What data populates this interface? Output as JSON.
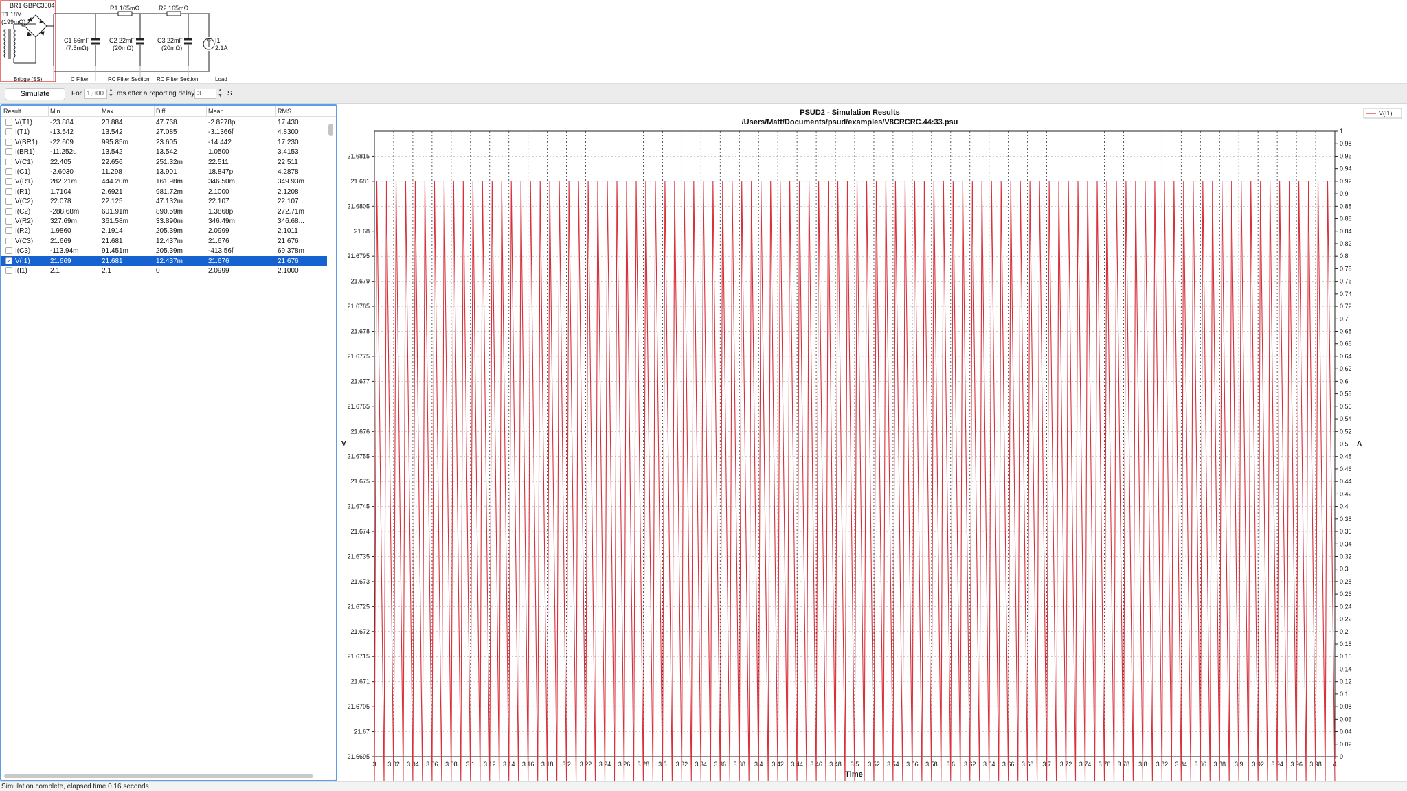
{
  "schematic": {
    "bridge_label": "BR1 GBPC3504",
    "transformer_label": "T1 18V",
    "transformer_res": "(199mΩ)",
    "r1": "R1 165mΩ",
    "r2": "R2 165mΩ",
    "c1": "C1 66mF",
    "c1_esr": "(7.5mΩ)",
    "c2": "C2 22mF",
    "c2_esr": "(20mΩ)",
    "c3": "C3 22mF",
    "c3_esr": "(20mΩ)",
    "i1": "I1",
    "i1_value": "2.1A",
    "sections": [
      "Bridge (SS)",
      "C Filter",
      "RC Filter Section",
      "RC Filter Section",
      "Load"
    ]
  },
  "controls": {
    "simulate_label": "Simulate",
    "for_label": "For",
    "duration_value": "1,000",
    "after_label": "ms after a reporting delay",
    "delay_value": "3",
    "unit_label": "S"
  },
  "table": {
    "headers": [
      "Result",
      "Min",
      "Max",
      "Diff",
      "Mean",
      "RMS"
    ],
    "rows": [
      {
        "name": "V(T1)",
        "min": "-23.884",
        "max": "23.884",
        "diff": "47.768",
        "mean": "-2.8278p",
        "rms": "17.430",
        "checked": false
      },
      {
        "name": "I(T1)",
        "min": "-13.542",
        "max": "13.542",
        "diff": "27.085",
        "mean": "-3.1366f",
        "rms": "4.8300",
        "checked": false
      },
      {
        "name": "V(BR1)",
        "min": "-22.609",
        "max": "995.85m",
        "diff": "23.605",
        "mean": "-14.442",
        "rms": "17.230",
        "checked": false
      },
      {
        "name": "I(BR1)",
        "min": "-11.252u",
        "max": "13.542",
        "diff": "13.542",
        "mean": "1.0500",
        "rms": "3.4153",
        "checked": false
      },
      {
        "name": "V(C1)",
        "min": "22.405",
        "max": "22.656",
        "diff": "251.32m",
        "mean": "22.511",
        "rms": "22.511",
        "checked": false
      },
      {
        "name": "I(C1)",
        "min": "-2.6030",
        "max": "11.298",
        "diff": "13.901",
        "mean": "18.847p",
        "rms": "4.2878",
        "checked": false
      },
      {
        "name": "V(R1)",
        "min": "282.21m",
        "max": "444.20m",
        "diff": "161.98m",
        "mean": "346.50m",
        "rms": "349.93m",
        "checked": false
      },
      {
        "name": "I(R1)",
        "min": "1.7104",
        "max": "2.6921",
        "diff": "981.72m",
        "mean": "2.1000",
        "rms": "2.1208",
        "checked": false
      },
      {
        "name": "V(C2)",
        "min": "22.078",
        "max": "22.125",
        "diff": "47.132m",
        "mean": "22.107",
        "rms": "22.107",
        "checked": false
      },
      {
        "name": "I(C2)",
        "min": "-288.68m",
        "max": "601.91m",
        "diff": "890.59m",
        "mean": "1.3868p",
        "rms": "272.71m",
        "checked": false
      },
      {
        "name": "V(R2)",
        "min": "327.69m",
        "max": "361.58m",
        "diff": "33.890m",
        "mean": "346.49m",
        "rms": "346.68...",
        "checked": false
      },
      {
        "name": "I(R2)",
        "min": "1.9860",
        "max": "2.1914",
        "diff": "205.39m",
        "mean": "2.0999",
        "rms": "2.1011",
        "checked": false
      },
      {
        "name": "V(C3)",
        "min": "21.669",
        "max": "21.681",
        "diff": "12.437m",
        "mean": "21.676",
        "rms": "21.676",
        "checked": false
      },
      {
        "name": "I(C3)",
        "min": "-113.94m",
        "max": "91.451m",
        "diff": "205.39m",
        "mean": "-413.56f",
        "rms": "69.378m",
        "checked": false
      },
      {
        "name": "V(I1)",
        "min": "21.669",
        "max": "21.681",
        "diff": "12.437m",
        "mean": "21.676",
        "rms": "21.676",
        "checked": true
      },
      {
        "name": "I(I1)",
        "min": "2.1",
        "max": "2.1",
        "diff": "0",
        "mean": "2.0999",
        "rms": "2.1000",
        "checked": false
      }
    ]
  },
  "chart_data": {
    "type": "line",
    "title": "PSUD2 - Simulation Results",
    "subtitle": "/Users/Matt/Documents/psud/examples/V8CRCRC.44:33.psu",
    "xlabel": "Time",
    "ylabel": "V",
    "y2label": "A",
    "xlim": [
      3,
      4
    ],
    "ylim": [
      21.6695,
      21.682
    ],
    "y2lim": [
      0,
      1
    ],
    "x_ticks": [
      "3",
      "3.02",
      "3.04",
      "3.06",
      "3.08",
      "3.1",
      "3.12",
      "3.14",
      "3.16",
      "3.18",
      "3.2",
      "3.22",
      "3.24",
      "3.26",
      "3.28",
      "3.3",
      "3.32",
      "3.34",
      "3.36",
      "3.38",
      "3.4",
      "3.42",
      "3.44",
      "3.46",
      "3.48",
      "3.5",
      "3.52",
      "3.54",
      "3.56",
      "3.58",
      "3.6",
      "3.62",
      "3.64",
      "3.66",
      "3.68",
      "3.7",
      "3.72",
      "3.74",
      "3.76",
      "3.78",
      "3.8",
      "3.82",
      "3.84",
      "3.86",
      "3.88",
      "3.9",
      "3.92",
      "3.94",
      "3.96",
      "3.98",
      "4"
    ],
    "y_ticks": [
      "21.6695",
      "21.67",
      "21.6705",
      "21.671",
      "21.6715",
      "21.672",
      "21.6725",
      "21.673",
      "21.6735",
      "21.674",
      "21.6745",
      "21.675",
      "21.6755",
      "21.676",
      "21.6765",
      "21.677",
      "21.6775",
      "21.678",
      "21.6785",
      "21.679",
      "21.6795",
      "21.68",
      "21.6805",
      "21.681",
      "21.6815"
    ],
    "y2_ticks": [
      "0",
      "0.02",
      "0.04",
      "0.06",
      "0.08",
      "0.1",
      "0.12",
      "0.14",
      "0.16",
      "0.18",
      "0.2",
      "0.22",
      "0.24",
      "0.26",
      "0.28",
      "0.3",
      "0.32",
      "0.34",
      "0.36",
      "0.38",
      "0.4",
      "0.42",
      "0.44",
      "0.46",
      "0.48",
      "0.5",
      "0.52",
      "0.54",
      "0.56",
      "0.58",
      "0.6",
      "0.62",
      "0.64",
      "0.66",
      "0.68",
      "0.7",
      "0.72",
      "0.74",
      "0.76",
      "0.78",
      "0.8",
      "0.82",
      "0.84",
      "0.86",
      "0.88",
      "0.9",
      "0.92",
      "0.94",
      "0.96",
      "0.98",
      "1"
    ],
    "grid": true,
    "legend_position": "top-right",
    "series": [
      {
        "name": "V(I1)",
        "color": "#d9303a",
        "min": 21.669,
        "max": 21.681,
        "mean": 21.676,
        "frequency_hz": 100
      }
    ]
  },
  "status": {
    "text": "Simulation complete, elapsed time 0.16 seconds"
  }
}
